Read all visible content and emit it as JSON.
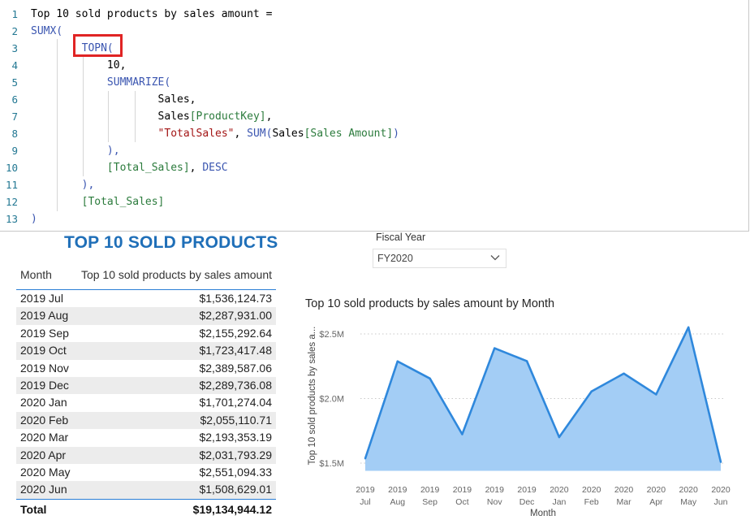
{
  "editor": {
    "lines": [
      {
        "num": "1",
        "tokens": [
          {
            "t": "Top 10 sold products by sales amount =",
            "c": "plain"
          }
        ]
      },
      {
        "num": "2",
        "tokens": [
          {
            "t": "SUMX(",
            "c": "kw"
          }
        ]
      },
      {
        "num": "3",
        "tokens": [
          {
            "t": "        ",
            "c": "plain"
          },
          {
            "t": "TOPN(",
            "c": "kw"
          }
        ]
      },
      {
        "num": "4",
        "tokens": [
          {
            "t": "            ",
            "c": "plain"
          },
          {
            "t": "10,",
            "c": "plain"
          }
        ]
      },
      {
        "num": "5",
        "tokens": [
          {
            "t": "            ",
            "c": "plain"
          },
          {
            "t": "SUMMARIZE(",
            "c": "kw"
          }
        ]
      },
      {
        "num": "6",
        "tokens": [
          {
            "t": "                    ",
            "c": "plain"
          },
          {
            "t": "Sales,",
            "c": "plain"
          }
        ]
      },
      {
        "num": "7",
        "tokens": [
          {
            "t": "                    ",
            "c": "plain"
          },
          {
            "t": "Sales",
            "c": "plain"
          },
          {
            "t": "[ProductKey]",
            "c": "col"
          },
          {
            "t": ",",
            "c": "plain"
          }
        ]
      },
      {
        "num": "8",
        "tokens": [
          {
            "t": "                    ",
            "c": "plain"
          },
          {
            "t": "\"TotalSales\"",
            "c": "str"
          },
          {
            "t": ", ",
            "c": "plain"
          },
          {
            "t": "SUM(",
            "c": "kw"
          },
          {
            "t": "Sales",
            "c": "plain"
          },
          {
            "t": "[Sales Amount]",
            "c": "col"
          },
          {
            "t": ")",
            "c": "kw"
          }
        ]
      },
      {
        "num": "9",
        "tokens": [
          {
            "t": "            ",
            "c": "plain"
          },
          {
            "t": "),",
            "c": "kw"
          }
        ]
      },
      {
        "num": "10",
        "tokens": [
          {
            "t": "            ",
            "c": "plain"
          },
          {
            "t": "[Total_Sales]",
            "c": "col"
          },
          {
            "t": ", ",
            "c": "plain"
          },
          {
            "t": "DESC",
            "c": "kw"
          }
        ]
      },
      {
        "num": "11",
        "tokens": [
          {
            "t": "        ",
            "c": "plain"
          },
          {
            "t": "),",
            "c": "kw"
          }
        ]
      },
      {
        "num": "12",
        "tokens": [
          {
            "t": "        ",
            "c": "plain"
          },
          {
            "t": "[Total_Sales]",
            "c": "col"
          }
        ]
      },
      {
        "num": "13",
        "tokens": [
          {
            "t": ")",
            "c": "kw"
          }
        ]
      }
    ]
  },
  "table": {
    "title": "TOP 10 SOLD PRODUCTS",
    "col_month": "Month",
    "col_amount": "Top 10 sold products by sales amount",
    "rows": [
      {
        "month": "2019 Jul",
        "amount": "$1,536,124.73"
      },
      {
        "month": "2019 Aug",
        "amount": "$2,287,931.00"
      },
      {
        "month": "2019 Sep",
        "amount": "$2,155,292.64"
      },
      {
        "month": "2019 Oct",
        "amount": "$1,723,417.48"
      },
      {
        "month": "2019 Nov",
        "amount": "$2,389,587.06"
      },
      {
        "month": "2019 Dec",
        "amount": "$2,289,736.08"
      },
      {
        "month": "2020 Jan",
        "amount": "$1,701,274.04"
      },
      {
        "month": "2020 Feb",
        "amount": "$2,055,110.71"
      },
      {
        "month": "2020 Mar",
        "amount": "$2,193,353.19"
      },
      {
        "month": "2020 Apr",
        "amount": "$2,031,793.29"
      },
      {
        "month": "2020 May",
        "amount": "$2,551,094.33"
      },
      {
        "month": "2020 Jun",
        "amount": "$1,508,629.01"
      }
    ],
    "total_label": "Total",
    "total_value": "$19,134,944.12"
  },
  "slicer": {
    "label": "Fiscal Year",
    "value": "FY2020"
  },
  "colors": {
    "accent": "#2b7fd6",
    "area_fill": "#a3cdf5",
    "line": "#2f88dc",
    "title_blue": "#1f6fb8",
    "highlight_red": "#e02424"
  },
  "chart_data": {
    "type": "area",
    "title": "Top 10 sold products by sales amount by Month",
    "xlabel": "Month",
    "ylabel": "Top 10 sold products by sales a...",
    "categories": [
      {
        "year": "2019",
        "month": "Jul"
      },
      {
        "year": "2019",
        "month": "Aug"
      },
      {
        "year": "2019",
        "month": "Sep"
      },
      {
        "year": "2019",
        "month": "Oct"
      },
      {
        "year": "2019",
        "month": "Nov"
      },
      {
        "year": "2019",
        "month": "Dec"
      },
      {
        "year": "2020",
        "month": "Jan"
      },
      {
        "year": "2020",
        "month": "Feb"
      },
      {
        "year": "2020",
        "month": "Mar"
      },
      {
        "year": "2020",
        "month": "Apr"
      },
      {
        "year": "2020",
        "month": "May"
      },
      {
        "year": "2020",
        "month": "Jun"
      }
    ],
    "values": [
      1536124.73,
      2287931.0,
      2155292.64,
      1723417.48,
      2389587.06,
      2289736.08,
      1701274.04,
      2055110.71,
      2193353.19,
      2031793.29,
      2551094.33,
      1508629.01
    ],
    "yticks": [
      {
        "value": 1500000,
        "label": "$1.5M"
      },
      {
        "value": 2000000,
        "label": "$2.0M"
      },
      {
        "value": 2500000,
        "label": "$2.5M"
      }
    ],
    "ylim": [
      1400000,
      2600000
    ],
    "grid": true
  }
}
